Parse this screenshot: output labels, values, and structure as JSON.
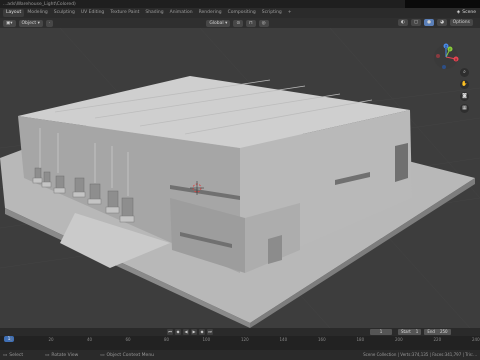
{
  "window": {
    "title": "...ads\\Warehouse_Light\\Colored)"
  },
  "workspaces": [
    "Layout",
    "Modeling",
    "Sculpting",
    "UV Editing",
    "Texture Paint",
    "Shading",
    "Animation",
    "Rendering",
    "Compositing",
    "Scripting",
    "+"
  ],
  "active_workspace_index": 0,
  "scene_label": "Scene",
  "header": {
    "mode": "Object",
    "orientation": "Global",
    "options": "Options"
  },
  "timeline": {
    "current_frame": "1",
    "start_label": "Start",
    "start_value": "1",
    "end_label": "End",
    "end_value": "250"
  },
  "ruler": {
    "playhead": "1",
    "ticks": [
      "0",
      "20",
      "40",
      "60",
      "80",
      "100",
      "120",
      "140",
      "160",
      "180",
      "200",
      "220",
      "240"
    ]
  },
  "status": {
    "left": "Select",
    "middle": "Rotate View",
    "right_mid": "Object Context Menu",
    "stats": "Scene Collection | Verts:374,135 | Faces:341,797 | Tris:..."
  },
  "gizmo": {
    "x": "X",
    "y": "Y",
    "z": "Z"
  },
  "icons": [
    "zoom-icon",
    "hand-icon",
    "camera-icon",
    "grid-icon"
  ],
  "colors": {
    "viewport_bg": "#3d3d3d",
    "building_light": "#bdbdbd",
    "building_mid": "#a4a4a4",
    "building_roof": "#cfcfcf",
    "ground": "#b8b8b8",
    "axis_x": "#e64452",
    "axis_y": "#88cc3c",
    "axis_z": "#4a8ae6"
  }
}
